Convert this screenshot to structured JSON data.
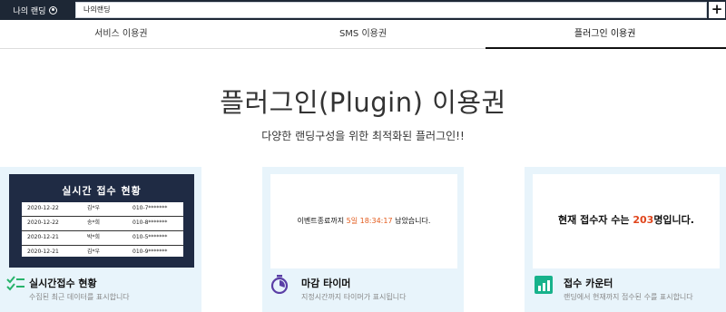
{
  "topbar": {
    "mypage_label": "나의 랜딩",
    "page_tab_label": "나의랜딩",
    "add_label": "+"
  },
  "tabs": [
    {
      "label": "서비스 이용권"
    },
    {
      "label": "SMS 이용권"
    },
    {
      "label": "플러그인 이용권"
    }
  ],
  "hero": {
    "title": "플러그인(Plugin) 이용권",
    "subtitle": "다양한 랜딩구성을 위한 최적화된 플러그인!!"
  },
  "cards": [
    {
      "name": "실시간접수 현황",
      "desc": "수집된 최근 데이터를 표시합니다",
      "board": {
        "title": "실시간 접수 현황",
        "rows": [
          {
            "date": "2020-12-22",
            "name": "김*우",
            "phone": "010-7*******"
          },
          {
            "date": "2020-12-22",
            "name": "송*희",
            "phone": "010-8*******"
          },
          {
            "date": "2020-12-21",
            "name": "박*희",
            "phone": "010-5*******"
          },
          {
            "date": "2020-12-21",
            "name": "김*우",
            "phone": "010-9*******"
          }
        ]
      }
    },
    {
      "name": "마감 타이머",
      "desc": "지정시간까지 타이머가 표시됩니다",
      "timer": {
        "prefix": "이벤트종료까지 ",
        "remaining": "5일 18:34:17",
        "suffix": " 남았습니다."
      }
    },
    {
      "name": "접수 카운터",
      "desc": "랜딩에서 현재까지 접수된 수를 표시합니다",
      "counter": {
        "prefix": "현재 접수자 수는 ",
        "count": "203",
        "suffix": "명입니다."
      }
    }
  ],
  "colors": {
    "accent_red": "#e0451c",
    "dark_navy": "#1d2735",
    "card_bg": "#e8f4fb",
    "icon_green": "#27b36b",
    "icon_purple": "#5b3fa6",
    "icon_teal": "#17b28b"
  }
}
